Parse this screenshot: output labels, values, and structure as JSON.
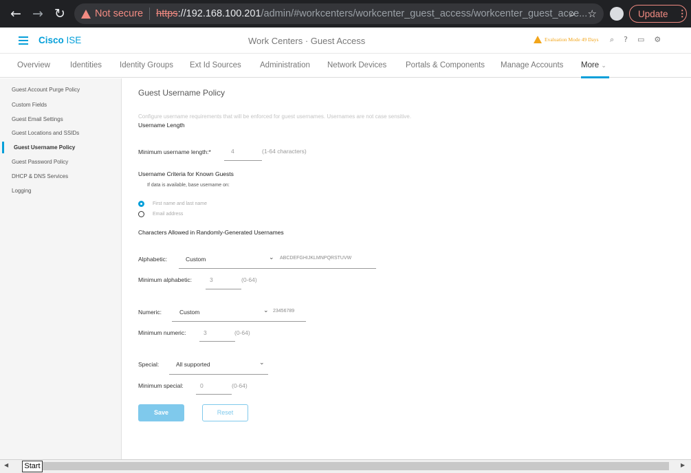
{
  "browser": {
    "not_secure": "Not secure",
    "url_scheme": "https",
    "url_host": "://192.168.100.201",
    "url_rest": "/admin/#workcenters/workcenter_guest_access/workcenter_guest_acce...",
    "update_label": "Update"
  },
  "header": {
    "brand_bold": "Cisco",
    "brand_rest": " ISE",
    "breadcrumb": "Work Centers · Guest Access",
    "evaluation": "Evaluation Mode 49 Days"
  },
  "tabs": [
    "Overview",
    "Identities",
    "Identity Groups",
    "Ext Id Sources",
    "Administration",
    "Network Devices",
    "Portals & Components",
    "Manage Accounts",
    "More"
  ],
  "sidebar": {
    "items": [
      "Guest Account Purge Policy",
      "Custom Fields",
      "Guest Email Settings",
      "Guest Locations and SSIDs",
      "Guest Username Policy",
      "Guest Password Policy",
      "DHCP & DNS Services",
      "Logging"
    ],
    "active_index": 4
  },
  "main": {
    "title": "Guest Username Policy",
    "description": "Configure username requirements that will be enforced for guest usernames. Usernames are not case sensitive.",
    "username_length_heading": "Username Length",
    "min_length_label": "Minimum username length:*",
    "min_length_value": "4",
    "min_length_hint": "(1-64 characters)",
    "criteria_heading": "Username Criteria for Known Guests",
    "criteria_sub": "If data is available, base username on:",
    "radio_first_last": "First name and last name",
    "radio_email": "Email address",
    "radio_selected": "first_last",
    "chars_heading": "Characters Allowed in Randomly-Generated Usernames",
    "alpha_label": "Alphabetic:",
    "alpha_select": "Custom",
    "alpha_chars": "ABCDEFGHIJKLMNPQRSTUVW",
    "min_alpha_label": "Minimum alphabetic:",
    "min_alpha_value": "3",
    "min_alpha_hint": "(0-64)",
    "numeric_label": "Numeric:",
    "numeric_select": "Custom",
    "numeric_chars": "23456789",
    "min_numeric_label": "Minimum numeric:",
    "min_numeric_value": "3",
    "min_numeric_hint": "(0-64)",
    "special_label": "Special:",
    "special_select": "All supported",
    "min_special_label": "Minimum special:",
    "min_special_value": "0",
    "min_special_hint": "(0-64)",
    "save_label": "Save",
    "reset_label": "Reset"
  },
  "taskbar": {
    "start_label": "Start"
  },
  "colors": {
    "accent": "#049fd9",
    "warning": "#f2a51a",
    "browser_warning": "#f28b82"
  }
}
